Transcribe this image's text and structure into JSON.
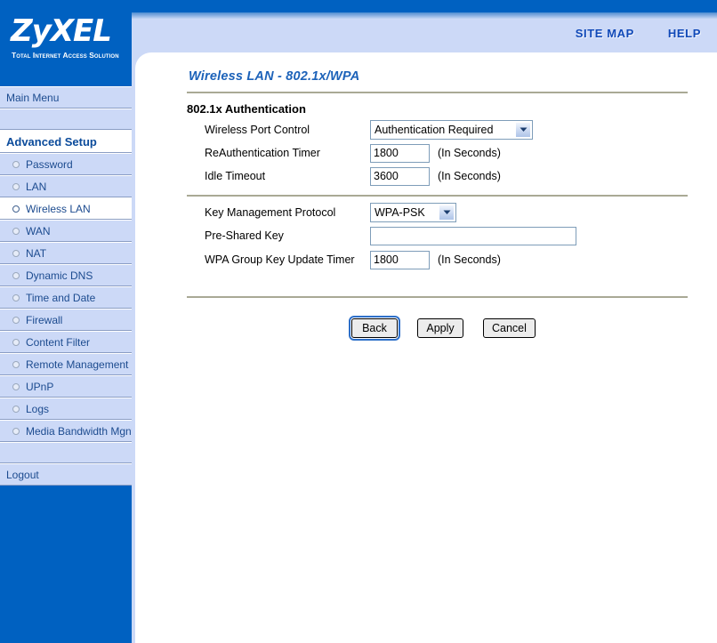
{
  "brand": {
    "name": "ZyXEL",
    "tagline": "Total Internet Access Solution"
  },
  "header": {
    "site_map": "SITE MAP",
    "help": "HELP"
  },
  "sidebar": {
    "main_menu": "Main Menu",
    "advanced_setup": "Advanced Setup",
    "items": [
      {
        "label": "Password",
        "active": false
      },
      {
        "label": "LAN",
        "active": false
      },
      {
        "label": "Wireless LAN",
        "active": true
      },
      {
        "label": "WAN",
        "active": false
      },
      {
        "label": "NAT",
        "active": false
      },
      {
        "label": "Dynamic DNS",
        "active": false
      },
      {
        "label": "Time and Date",
        "active": false
      },
      {
        "label": "Firewall",
        "active": false
      },
      {
        "label": "Content Filter",
        "active": false
      },
      {
        "label": "Remote Management",
        "active": false
      },
      {
        "label": "UPnP",
        "active": false
      },
      {
        "label": "Logs",
        "active": false
      },
      {
        "label": "Media Bandwidth Mgnt.",
        "active": false
      }
    ],
    "logout": "Logout"
  },
  "main": {
    "page_title": "Wireless LAN - 802.1x/WPA",
    "section_auth": {
      "title": "802.1x Authentication",
      "port_control": {
        "label": "Wireless Port Control",
        "value": "Authentication Required"
      },
      "reauth_timer": {
        "label": "ReAuthentication Timer",
        "value": "1800",
        "hint": "(In Seconds)"
      },
      "idle_timeout": {
        "label": "Idle Timeout",
        "value": "3600",
        "hint": "(In Seconds)"
      }
    },
    "section_key": {
      "key_management": {
        "label": "Key Management Protocol",
        "value": "WPA-PSK"
      },
      "pre_shared_key": {
        "label": "Pre-Shared Key",
        "value": ""
      },
      "group_key_timer": {
        "label": "WPA Group Key Update Timer",
        "value": "1800",
        "hint": "(In Seconds)"
      }
    },
    "buttons": {
      "back": "Back",
      "apply": "Apply",
      "cancel": "Cancel"
    }
  },
  "colors": {
    "brand_blue": "#0061c1",
    "panel_blue": "#ccd9f7",
    "title_blue": "#1c62b9",
    "link_blue": "#1049b8",
    "divider": "#a9a995"
  }
}
